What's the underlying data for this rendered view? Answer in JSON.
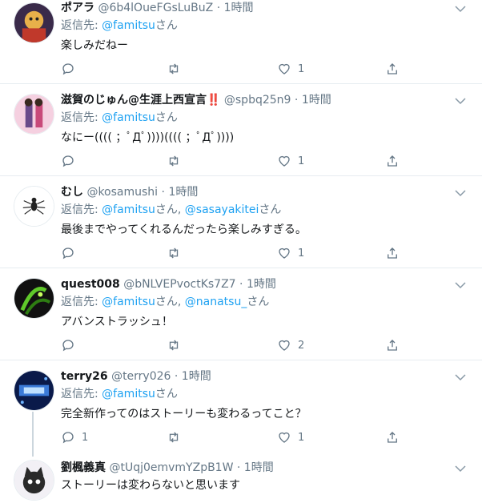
{
  "tweets": [
    {
      "name": "ポアラ",
      "handle": "@6b4lOueFGsLuBuZ",
      "time": "1時間",
      "reply_prefix": "返信先: ",
      "mentions": [
        "@famitsu"
      ],
      "san": "さん",
      "text": "楽しみだねー",
      "replies": "",
      "likes": "1"
    },
    {
      "name": "滋賀のじゅん@生涯上西宣言",
      "name_emoji": "‼️",
      "handle": "@spbq25n9",
      "time": "1時間",
      "reply_prefix": "返信先: ",
      "mentions": [
        "@famitsu"
      ],
      "san": "さん",
      "text": "なにー(((( ；ﾟДﾟ))))(((( ；ﾟДﾟ))))",
      "replies": "",
      "likes": "1"
    },
    {
      "name": "むし",
      "handle": "@kosamushi",
      "time": "1時間",
      "reply_prefix": "返信先: ",
      "mentions": [
        "@famitsu",
        "@sasayakitei"
      ],
      "san": "さん",
      "separator": ", ",
      "text": "最後までやってくれるんだったら楽しみすぎる。",
      "replies": "",
      "likes": "1"
    },
    {
      "name": "quest008",
      "handle": "@bNLVEPvoctKs7Z7",
      "time": "1時間",
      "reply_prefix": "返信先: ",
      "mentions": [
        "@famitsu",
        "@nanatsu_"
      ],
      "san": "さん",
      "separator": ", ",
      "text": "アバンストラッシュ！",
      "replies": "",
      "likes": "2"
    },
    {
      "name": "terry26",
      "handle": "@terry026",
      "time": "1時間",
      "reply_prefix": "返信先: ",
      "mentions": [
        "@famitsu"
      ],
      "san": "さん",
      "text": "完全新作ってのはストーリーも変わるってこと？",
      "replies": "1",
      "likes": "1"
    },
    {
      "name": "劉楓義真",
      "handle": "@tUqj0emvmYZpB1W",
      "time": "1時間",
      "text": "ストーリーは変わらないと思います"
    }
  ],
  "dot": " · ",
  "icons": {
    "reply": "reply-icon",
    "retweet": "retweet-icon",
    "like": "heart-icon",
    "share": "share-icon",
    "more": "chevron-down-icon"
  },
  "colors": {
    "link": "#1da1f2",
    "muted": "#657786",
    "divider": "#e6ecf0",
    "alert": "#e0245e"
  }
}
